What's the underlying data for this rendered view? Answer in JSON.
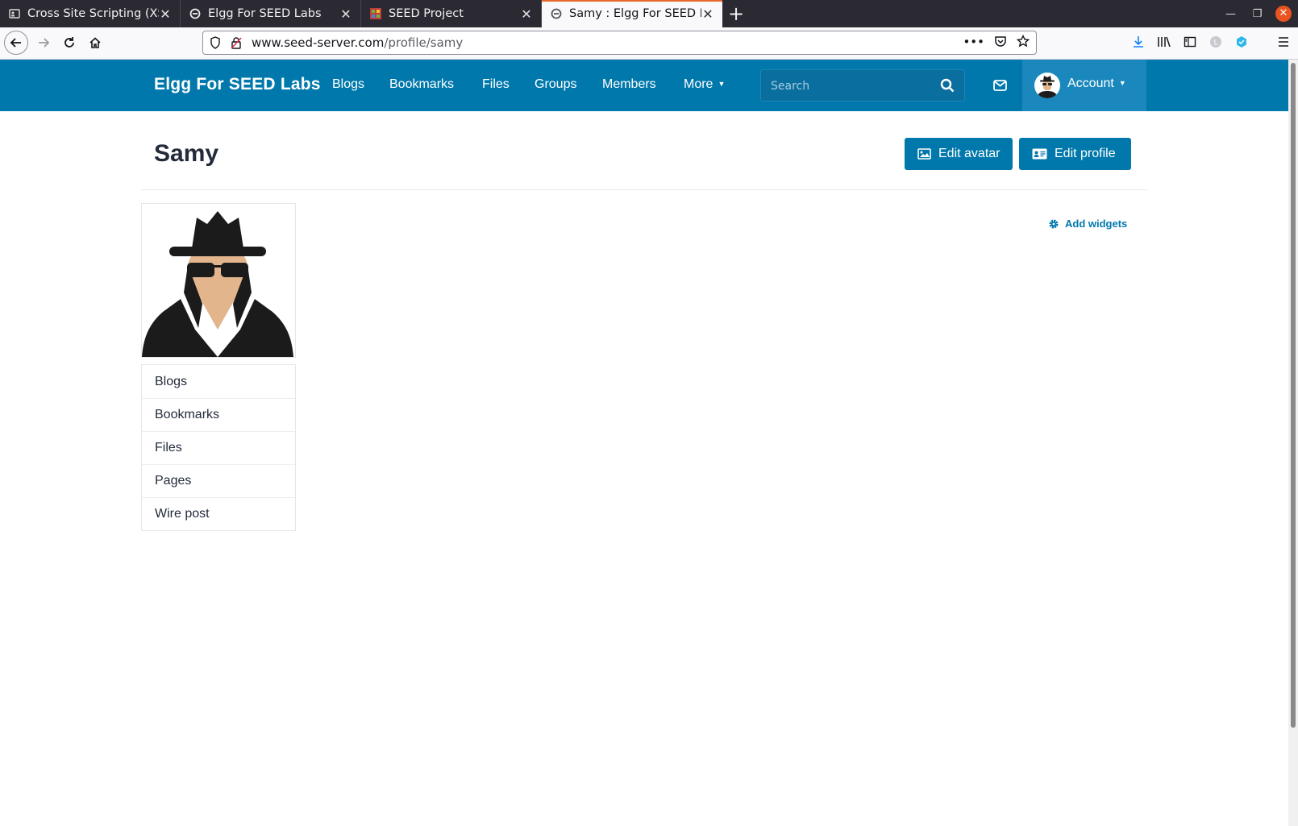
{
  "browser": {
    "tabs": [
      {
        "title": "Cross Site Scripting (XSS)",
        "icon": "document-icon",
        "active": false
      },
      {
        "title": "Elgg For SEED Labs",
        "icon": "elgg-icon",
        "active": false
      },
      {
        "title": "SEED Project",
        "icon": "seed-icon",
        "active": false
      },
      {
        "title": "Samy : Elgg For SEED Labs",
        "icon": "elgg-icon",
        "active": true
      }
    ],
    "new_tab": "+",
    "url_host": "www.seed-server.com",
    "url_path": "/profile/samy",
    "url_actions": "•••"
  },
  "site": {
    "name": "Elgg For SEED Labs",
    "menu": [
      "Blogs",
      "Bookmarks",
      "Files",
      "Groups",
      "Members",
      "More"
    ],
    "search_placeholder": "Search",
    "account_label": "Account"
  },
  "profile": {
    "title": "Samy",
    "edit_avatar": "Edit avatar",
    "edit_profile": "Edit profile",
    "add_widgets": "Add widgets",
    "owner_menu": [
      "Blogs",
      "Bookmarks",
      "Files",
      "Pages",
      "Wire post"
    ]
  },
  "colors": {
    "brand": "#0078ac",
    "chrome_dark": "#2b2a33",
    "active_tab_accent": "#e8672a"
  }
}
